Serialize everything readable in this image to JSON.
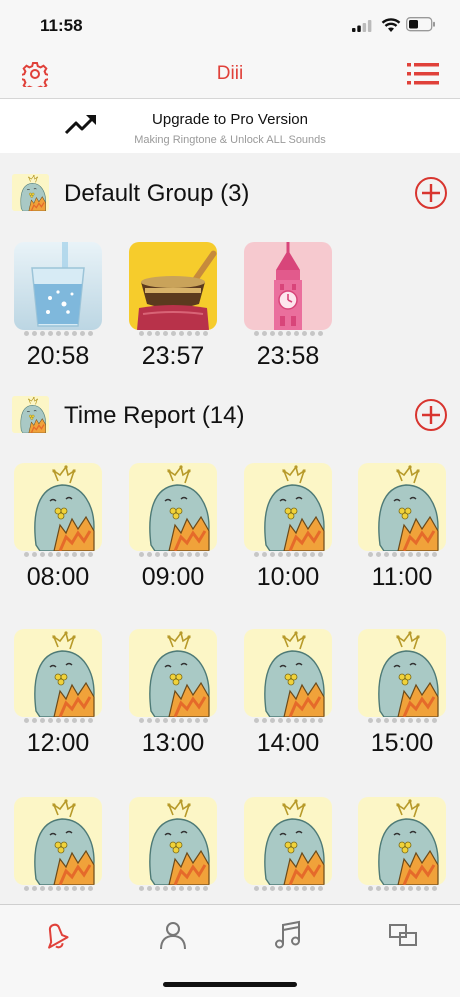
{
  "status_bar": {
    "time": "11:58"
  },
  "nav": {
    "title": "Diii",
    "accent": "#e0413a"
  },
  "banner": {
    "title": "Upgrade to Pro Version",
    "subtitle": "Making Ringtone & Unlock ALL Sounds"
  },
  "groups": [
    {
      "title": "Default Group (3)",
      "items": [
        {
          "label": "20:58",
          "icon": "water-glass-thumbnail"
        },
        {
          "label": "23:57",
          "icon": "singing-bowl-thumbnail"
        },
        {
          "label": "23:58",
          "icon": "clock-tower-thumbnail"
        }
      ]
    },
    {
      "title": "Time Report (14)",
      "items": [
        {
          "label": "08:00",
          "icon": "bird-character-thumbnail"
        },
        {
          "label": "09:00",
          "icon": "bird-character-thumbnail"
        },
        {
          "label": "10:00",
          "icon": "bird-character-thumbnail"
        },
        {
          "label": "11:00",
          "icon": "bird-character-thumbnail"
        },
        {
          "label": "12:00",
          "icon": "bird-character-thumbnail"
        },
        {
          "label": "13:00",
          "icon": "bird-character-thumbnail"
        },
        {
          "label": "14:00",
          "icon": "bird-character-thumbnail"
        },
        {
          "label": "15:00",
          "icon": "bird-character-thumbnail"
        },
        {
          "icon": "bird-character-thumbnail"
        },
        {
          "icon": "bird-character-thumbnail"
        },
        {
          "icon": "bird-character-thumbnail"
        },
        {
          "icon": "bird-character-thumbnail"
        }
      ]
    }
  ],
  "tabbar": [
    {
      "icon": "bell-icon",
      "active": true
    },
    {
      "icon": "person-icon",
      "active": false
    },
    {
      "icon": "music-note-icon",
      "active": false
    },
    {
      "icon": "copy-icon",
      "active": false
    }
  ]
}
